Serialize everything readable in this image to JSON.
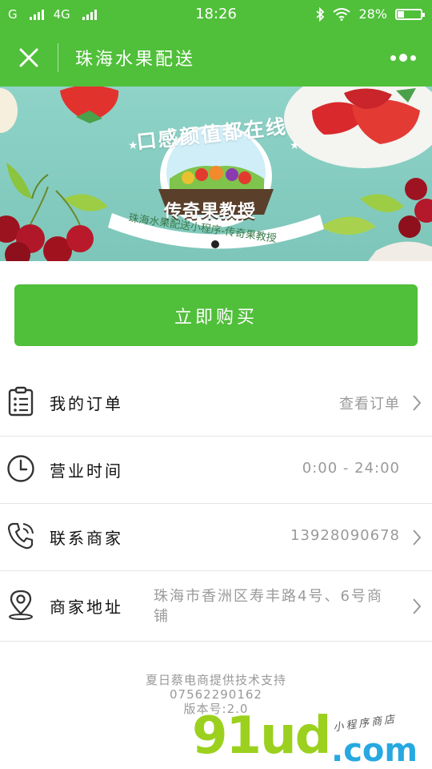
{
  "status_bar": {
    "carrier1": "G",
    "carrier2": "4G",
    "time": "18:26",
    "battery": "28%",
    "battery_level": 0.28
  },
  "navbar": {
    "title": "珠海水果配送",
    "close_icon": "close-icon",
    "more_icon": "more-icon"
  },
  "banner": {
    "slogan": "口感颜值都在线",
    "brand": "传奇果教授",
    "ribbon": "珠海水果配送小程序-传奇果教授",
    "slides_total": 1,
    "active_slide": 1
  },
  "buy_button": "立即购买",
  "rows": [
    {
      "label": "我的订单",
      "value": "查看订单",
      "icon": "clipboard-icon",
      "chevron": true
    },
    {
      "label": "营业时间",
      "value": "0:00 - 24:00",
      "icon": "clock-icon",
      "chevron": false
    },
    {
      "label": "联系商家",
      "value": "13928090678",
      "icon": "phone-icon",
      "chevron": true
    },
    {
      "label": "商家地址",
      "value": "珠海市香洲区寿丰路4号、6号商铺",
      "icon": "location-pin-icon",
      "chevron": true
    }
  ],
  "footer": {
    "line1": "夏日蔡电商提供技术支持",
    "line2": "07562290162",
    "line3": "版本号:2.0"
  },
  "watermark": {
    "main": "91ud",
    "domain": ".com",
    "sub": "小程序商店"
  },
  "colors": {
    "brand_green": "#50bf3a",
    "divider": "#e5e5e5",
    "muted_text": "#9a9a9a"
  }
}
